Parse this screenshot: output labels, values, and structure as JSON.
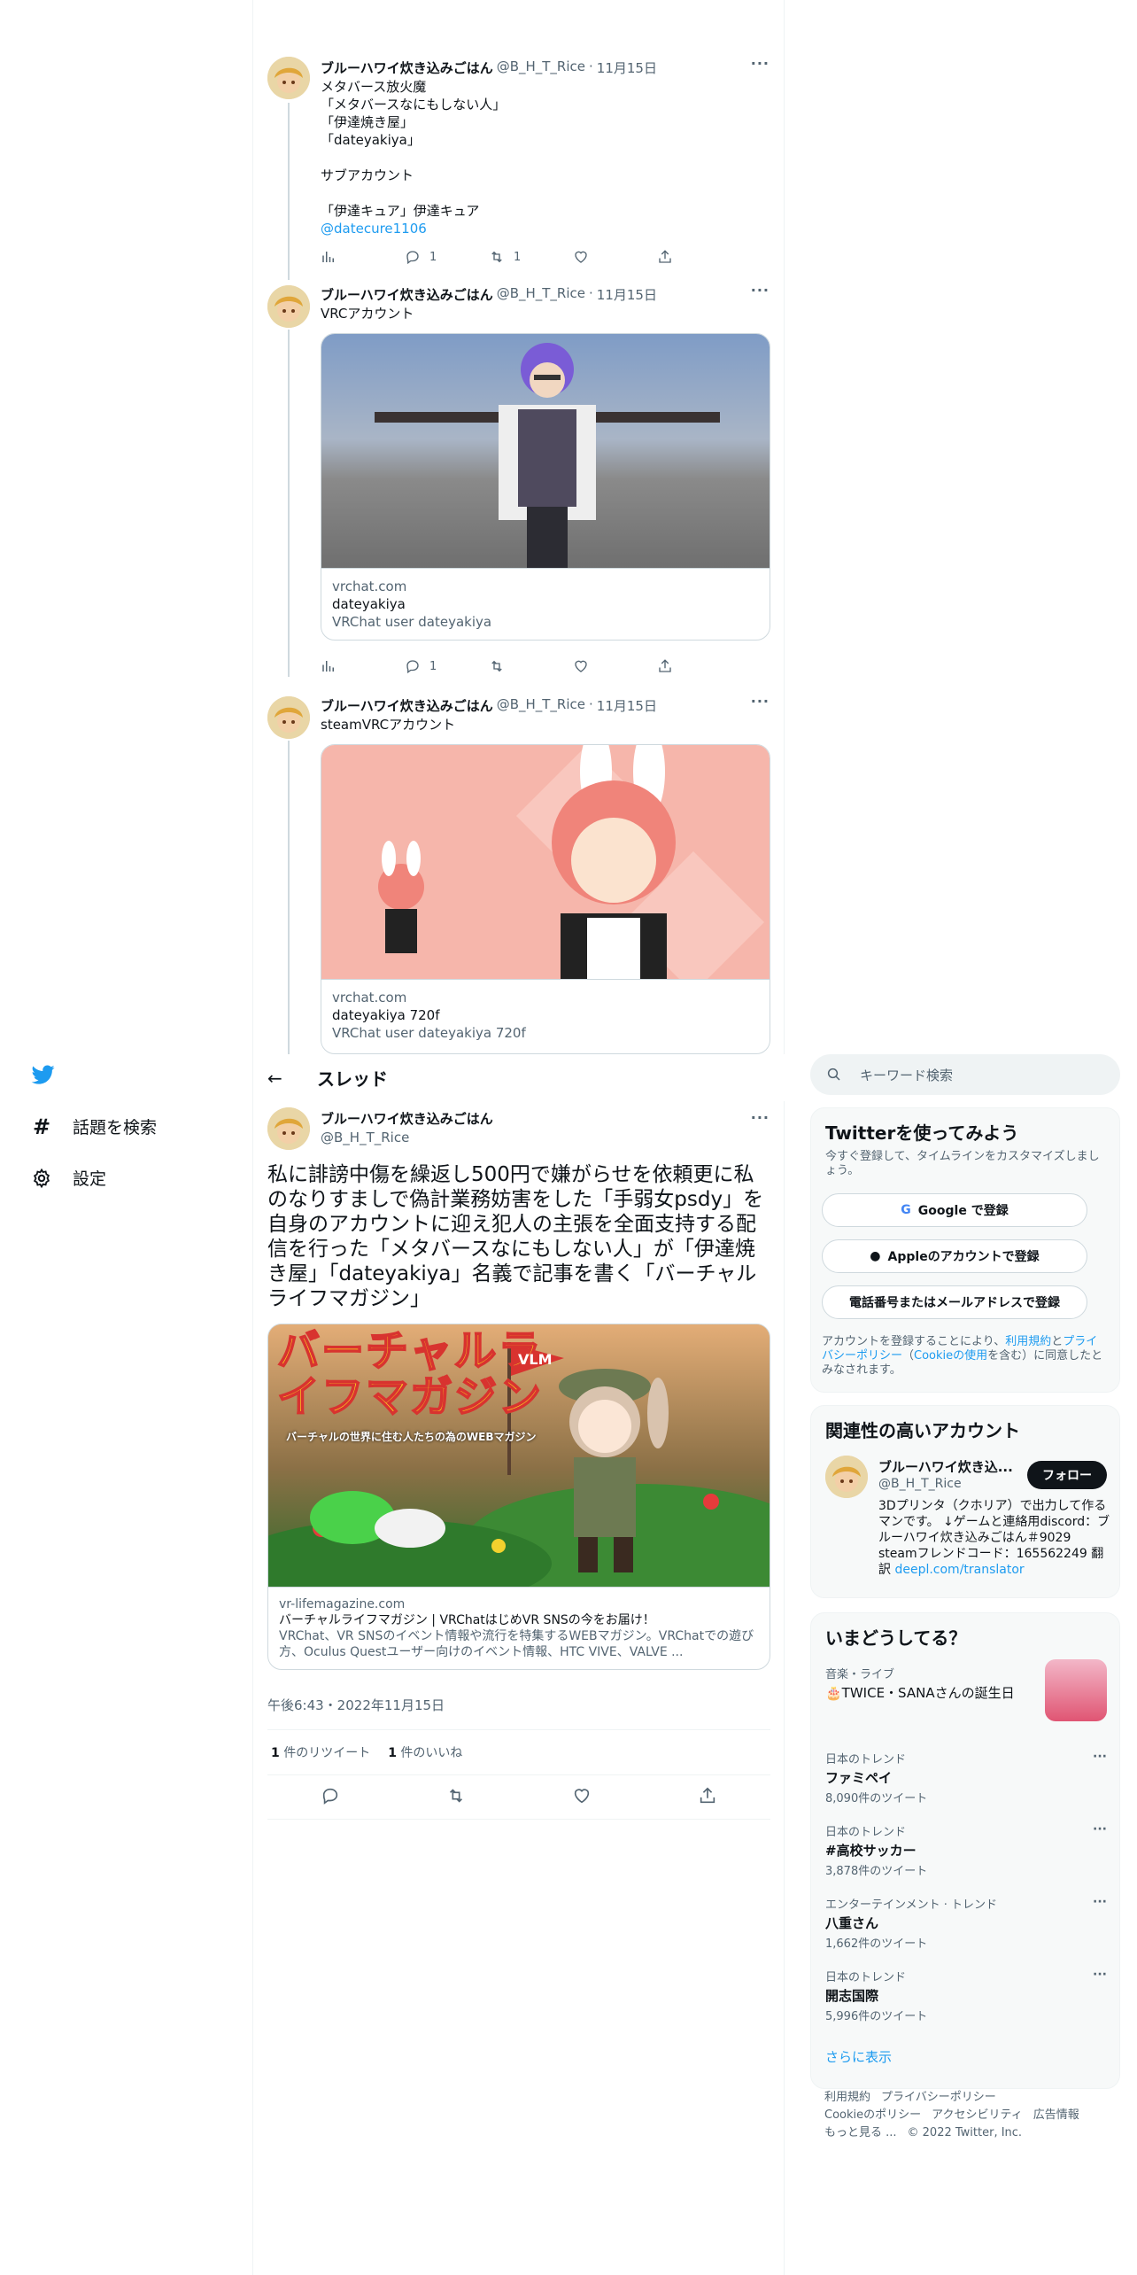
{
  "nav": {
    "logo_icon": "twitter-bird-icon",
    "items": [
      {
        "label": "話題を検索",
        "icon": "hashtag-icon"
      },
      {
        "label": "設定",
        "icon": "gear-icon"
      }
    ]
  },
  "tweets": [
    {
      "name": "ブルーハワイ炊き込みごはん",
      "handle": "@B_H_T_Rice",
      "date": "11月15日",
      "text": "メタバース放火魔\n「メタバースなにもしない人」\n「伊達焼き屋」\n「dateyakiya」\n\nサブアカウント\n\n「伊達キュア」伊達キュア",
      "link": "@datecure1106",
      "replies": "1",
      "retweets": "1"
    },
    {
      "name": "ブルーハワイ炊き込みごはん",
      "handle": "@B_H_T_Rice",
      "date": "11月15日",
      "text": "VRCアカウント",
      "card": {
        "domain": "vrchat.com",
        "title": "dateyakiya",
        "desc": "VRChat user dateyakiya"
      },
      "replies": "1",
      "retweets": ""
    },
    {
      "name": "ブルーハワイ炊き込みごはん",
      "handle": "@B_H_T_Rice",
      "date": "11月15日",
      "text": "steamVRCアカウント",
      "card": {
        "domain": "vrchat.com",
        "title": "dateyakiya 720f",
        "desc": "VRChat user dateyakiya 720f"
      }
    }
  ],
  "thread": {
    "title": "スレッド",
    "name": "ブルーハワイ炊き込みごはん",
    "handle": "@B_H_T_Rice",
    "text": "私に誹謗中傷を繰返し500円で嫌がらせを依頼更に私のなりすましで偽計業務妨害をした「手弱女psdy」を自身のアカウントに迎え犯人の主張を全面支持する配信を行った「メタバースなにもしない人」が「伊達焼き屋」「dateyakiya」名義で記事を書く「バーチャルライフマガジン」",
    "card": {
      "image_title": "バーチャルライフマガジン",
      "image_sub": "バーチャルの世界に住む人たちの為のWEBマガジン",
      "flag": "VLM",
      "domain": "vr-lifemagazine.com",
      "title": "バーチャルライフマガジン | VRChatはじめVR SNSの今をお届け！",
      "desc": "VRChat、VR SNSのイベント情報や流行を特集するWEBマガジン。VRChatでの遊び方、Oculus Questユーザー向けのイベント情報、HTC VIVE、VALVE ..."
    },
    "timestamp": "午後6:43・2022年11月15日",
    "retweets_count": "1",
    "retweets_label": "件のリツイート",
    "likes_count": "1",
    "likes_label": "件のいいね"
  },
  "right": {
    "search_placeholder": "キーワード検索",
    "signup": {
      "title": "Twitterを使ってみよう",
      "desc": "今すぐ登録して、タイムラインをカスタマイズしましょう。",
      "google": "Google で登録",
      "apple": "Appleのアカウントで登録",
      "phone": "電話番号またはメールアドレスで登録",
      "legal_pre": "アカウントを登録することにより、",
      "legal_link1": "利用規約",
      "legal_mid": "と",
      "legal_link2": "プライバシーポリシー",
      "legal_mid2": "（",
      "legal_link3": "Cookieの使用",
      "legal_post": "を含む）に同意したとみなされます。"
    },
    "related": {
      "title": "関連性の高いアカウント",
      "name": "ブルーハワイ炊き込...",
      "handle": "@B_H_T_Rice",
      "follow": "フォロー",
      "bio": "3Dプリンタ（クホリア）で出力して作るマンです。 ↓ゲームと連絡用discord：ブルーハワイ炊き込みごはん＃9029 steamフレンドコード：165562249 翻訳 ",
      "bio_link": "deepl.com/translator"
    },
    "trends": {
      "title": "いまどうしてる？",
      "featured": {
        "cat": "音楽・ライブ",
        "name": "🎂TWICE・SANAさんの誕生日"
      },
      "items": [
        {
          "cat": "日本のトレンド",
          "name": "ファミペイ",
          "count": "8,090件のツイート"
        },
        {
          "cat": "日本のトレンド",
          "name": "#高校サッカー",
          "count": "3,878件のツイート"
        },
        {
          "cat": "エンターテインメント · トレンド",
          "name": "八重さん",
          "count": "1,662件のツイート"
        },
        {
          "cat": "日本のトレンド",
          "name": "開志国際",
          "count": "5,996件のツイート"
        }
      ],
      "show_more": "さらに表示"
    },
    "footer": {
      "links": [
        "利用規約",
        "プライバシーポリシー",
        "Cookieのポリシー",
        "アクセシビリティ",
        "広告情報",
        "もっと見る ..."
      ],
      "copyright": "© 2022 Twitter, Inc."
    }
  },
  "colors": {
    "accent": "#1d9bf0",
    "text": "#0f1419",
    "muted": "#536471",
    "border": "#cfd9de"
  }
}
